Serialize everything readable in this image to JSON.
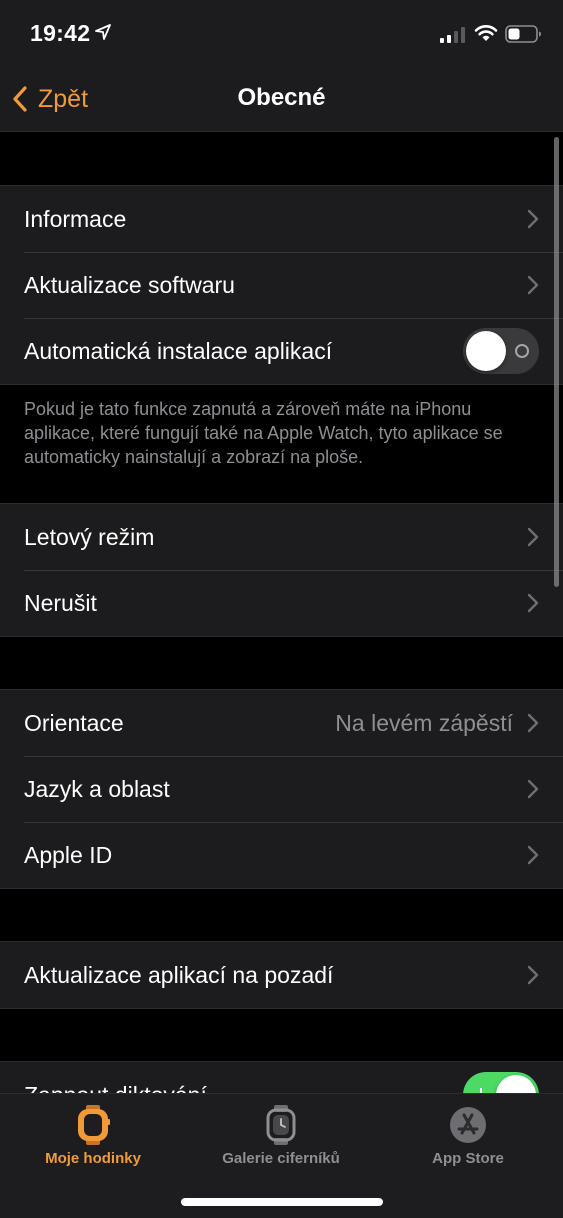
{
  "status_bar": {
    "time": "19:42",
    "icons": [
      "location-arrow-icon",
      "cellular-signal-icon",
      "wifi-icon",
      "battery-icon"
    ]
  },
  "nav": {
    "back_label": "Zpět",
    "title": "Obecné"
  },
  "groups": {
    "first": [
      {
        "label": "Informace"
      },
      {
        "label": "Aktualizace softwaru"
      },
      {
        "label": "Automatická instalace aplikací",
        "toggle": "off"
      }
    ],
    "first_footer": "Pokud je tato funkce zapnutá a zároveň máte na iPhonu aplikace, které fungují také na Apple Watch, tyto aplikace se automaticky nainstalují a zobrazí na ploše.",
    "second": [
      {
        "label": "Letový režim"
      },
      {
        "label": "Nerušit"
      }
    ],
    "third": [
      {
        "label": "Orientace",
        "value": "Na levém zápěstí"
      },
      {
        "label": "Jazyk a oblast"
      },
      {
        "label": "Apple ID"
      }
    ],
    "fourth": [
      {
        "label": "Aktualizace aplikací na pozadí"
      }
    ],
    "fifth": [
      {
        "label": "Zapnout diktování",
        "toggle": "on"
      }
    ]
  },
  "tab_bar": {
    "tabs": [
      {
        "label": "Moje hodinky",
        "icon": "watch-icon",
        "active": true
      },
      {
        "label": "Galerie ciferníků",
        "icon": "watch-face-icon",
        "active": false
      },
      {
        "label": "App Store",
        "icon": "app-store-icon",
        "active": false
      }
    ]
  },
  "colors": {
    "accent": "#f19a38",
    "background": "#000000",
    "cell": "#1c1c1e",
    "secondary_text": "#8e8e93",
    "toggle_on": "#4cd964"
  }
}
